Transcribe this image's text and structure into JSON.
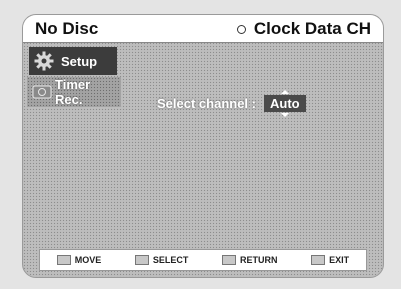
{
  "header": {
    "disc_status": "No Disc",
    "clock_label": "Clock Data CH"
  },
  "menu": {
    "items": [
      {
        "label": "Setup",
        "icon": "gear-icon",
        "active": true
      },
      {
        "label": "Timer Rec.",
        "icon": "timer-icon",
        "active": false
      }
    ]
  },
  "main": {
    "select_label": "Select channel :",
    "select_value": "Auto"
  },
  "footer": {
    "hints": [
      {
        "label": "MOVE",
        "icon": "move-icon"
      },
      {
        "label": "SELECT",
        "icon": "select-icon"
      },
      {
        "label": "RETURN",
        "icon": "return-icon"
      },
      {
        "label": "EXIT",
        "icon": "exit-icon"
      }
    ]
  },
  "colors": {
    "background": "#bdbdbd",
    "active_menu": "#3c3c3c",
    "value_box": "#4a4a4a"
  }
}
